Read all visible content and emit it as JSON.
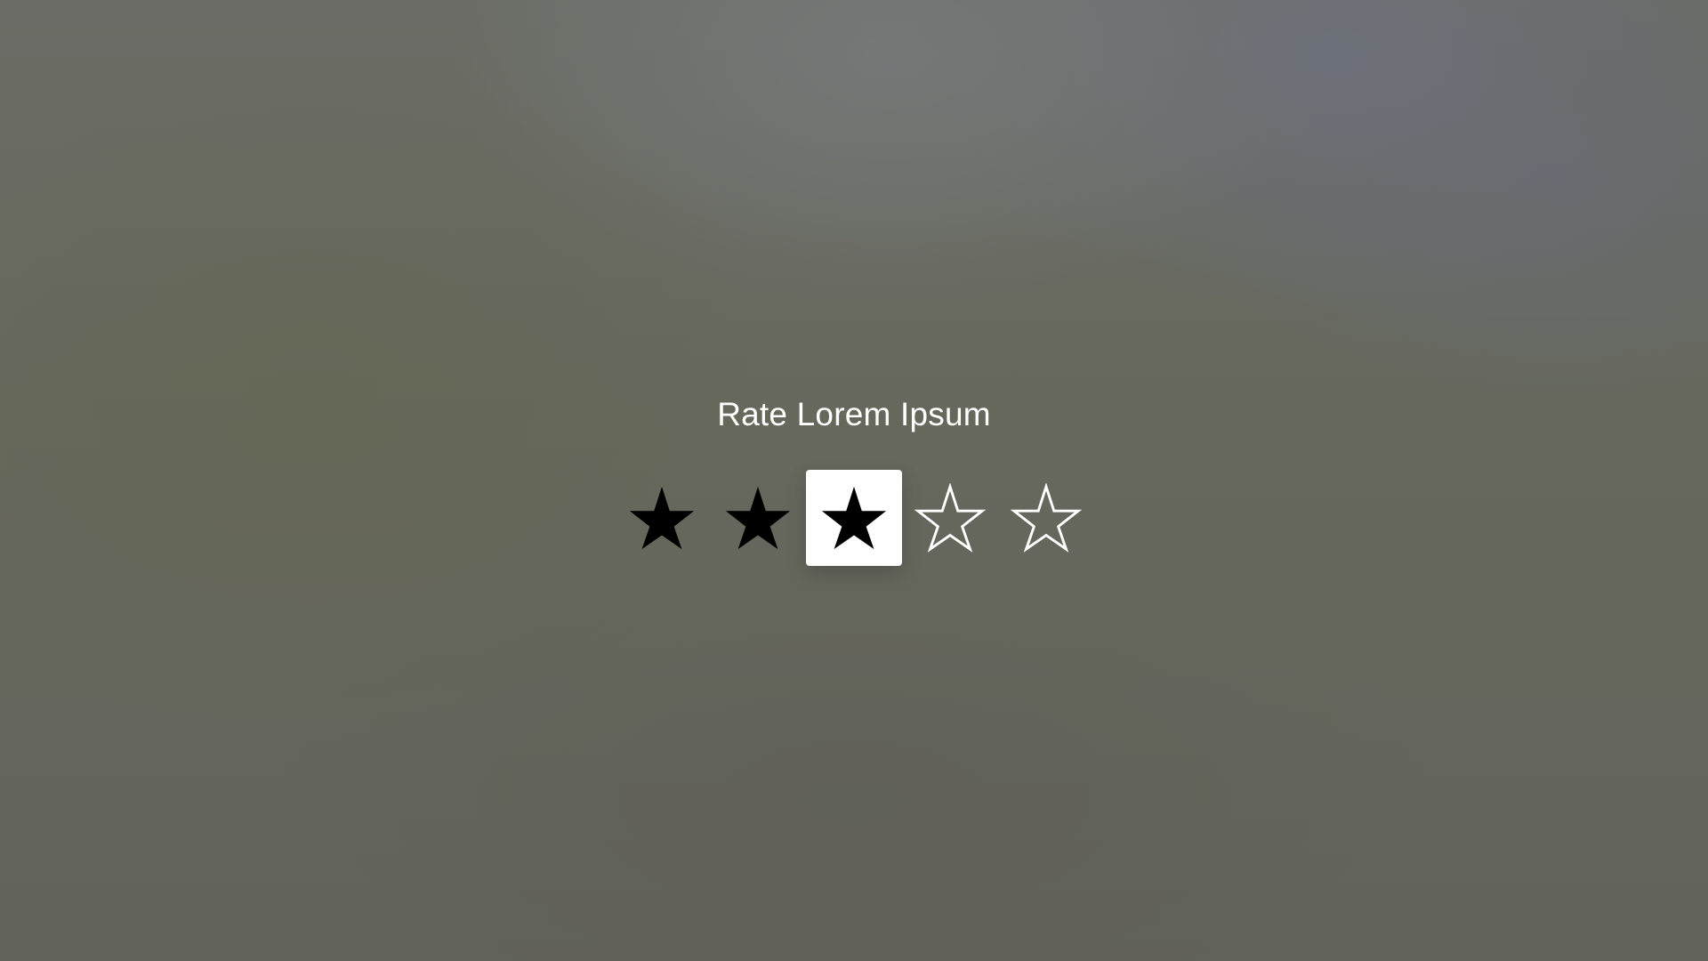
{
  "dialog": {
    "title": "Rate Lorem Ipsum"
  },
  "rating": {
    "value": 3,
    "max": 5,
    "focused_index": 3,
    "stars": [
      {
        "index": 1,
        "state": "filled",
        "icon": "star-filled-icon"
      },
      {
        "index": 2,
        "state": "filled",
        "icon": "star-filled-icon"
      },
      {
        "index": 3,
        "state": "filled",
        "icon": "star-filled-icon"
      },
      {
        "index": 4,
        "state": "empty",
        "icon": "star-outline-icon"
      },
      {
        "index": 5,
        "state": "empty",
        "icon": "star-outline-icon"
      }
    ]
  },
  "colors": {
    "filled_star": "#000000",
    "empty_star": "#ffffff",
    "focus_background": "#ffffff",
    "title_text": "#ffffff"
  }
}
